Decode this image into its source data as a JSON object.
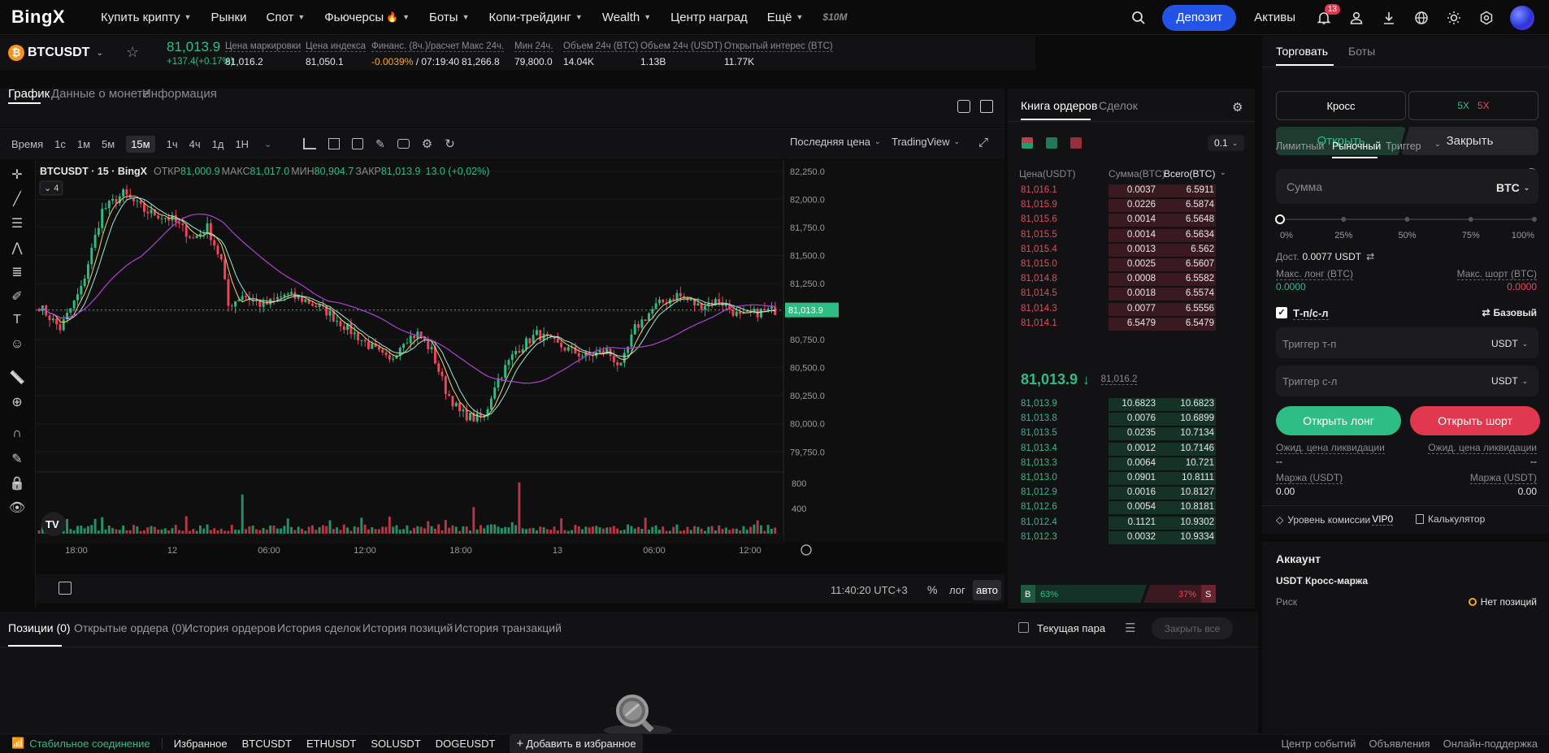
{
  "nav": {
    "logo": "BingX",
    "items": [
      {
        "label": "Купить крипту",
        "caret": true
      },
      {
        "label": "Рынки",
        "caret": false
      },
      {
        "label": "Спот",
        "caret": true
      },
      {
        "label": "Фьючерсы",
        "caret": true,
        "fire": true
      },
      {
        "label": "Боты",
        "caret": true
      },
      {
        "label": "Копи-трейдинг",
        "caret": true
      },
      {
        "label": "Wealth",
        "caret": true
      },
      {
        "label": "Центр наград",
        "caret": false
      },
      {
        "label": "Ещё",
        "caret": true
      }
    ],
    "promo": "$10M",
    "deposit": "Депозит",
    "assets": "Активы",
    "notif_count": "13"
  },
  "ticker": {
    "symbol": "BTCUSDT",
    "price": "81,013.9",
    "change": "+137.4(+0.17%)",
    "stats": [
      {
        "label": "Цена маркировки",
        "value": "81,016.2"
      },
      {
        "label": "Цена индекса",
        "value": "81,050.1"
      },
      {
        "label": "Финанс. (8ч.)/расчет",
        "value_red": "-0.0039%",
        "value": " / 07:19:40"
      },
      {
        "label": "Макс 24ч.",
        "value": "81,266.8"
      },
      {
        "label": "Мин 24ч.",
        "value": "79,800.0"
      },
      {
        "label": "Объем 24ч (BTC)",
        "value": "14.04K"
      },
      {
        "label": "Объем 24ч (USDT)",
        "value": "1.13B"
      },
      {
        "label": "Открытый интерес (BTC)",
        "value": "11.77K"
      }
    ]
  },
  "chart_tabs": [
    "График",
    "Данные о монете",
    "Информация"
  ],
  "toolbar": {
    "timeframes": [
      "Время",
      "1с",
      "1м",
      "5м",
      "15м",
      "1ч",
      "4ч",
      "1д",
      "1Н"
    ],
    "active": "15м",
    "price_type": "Последняя цена",
    "view": "TradingView"
  },
  "chart_data": {
    "type": "candlestick",
    "symbol_line": "BTCUSDT · 15 · BingX",
    "ohlc": {
      "o_label": "ОТКР",
      "o": "81,000.9",
      "h_label": "МАКС",
      "h": "81,017.0",
      "l_label": "МИН",
      "l": "80,904.7",
      "c_label": "ЗАКР",
      "c": "81,013.9",
      "chg": "13.0 (+0,02%)"
    },
    "indicator_count": "4",
    "y_ticks": [
      "82,250.0",
      "82,000.0",
      "81,750.0",
      "81,500.0",
      "81,250.0",
      "81,000.0",
      "80,750.0",
      "80,500.0",
      "80,250.0",
      "80,000.0",
      "79,750.0"
    ],
    "ylim": [
      79600,
      82350
    ],
    "last_price": "81,013.9",
    "last_price_value": 81013.9,
    "volume_ticks": [
      "800",
      "400"
    ],
    "x_ticks": [
      "18:00",
      "12",
      "06:00",
      "12:00",
      "18:00",
      "13",
      "06:00",
      "12:00"
    ],
    "waypoints": [
      [
        0,
        81050
      ],
      [
        6,
        80850
      ],
      [
        12,
        81200
      ],
      [
        18,
        81900
      ],
      [
        24,
        82050
      ],
      [
        30,
        81900
      ],
      [
        38,
        81820
      ],
      [
        44,
        81650
      ],
      [
        48,
        81750
      ],
      [
        52,
        81450
      ],
      [
        54,
        81050
      ],
      [
        58,
        81150
      ],
      [
        64,
        81050
      ],
      [
        70,
        81150
      ],
      [
        76,
        81100
      ],
      [
        82,
        81000
      ],
      [
        88,
        80850
      ],
      [
        96,
        80650
      ],
      [
        100,
        80550
      ],
      [
        104,
        80750
      ],
      [
        108,
        80800
      ],
      [
        112,
        80650
      ],
      [
        116,
        80300
      ],
      [
        120,
        80100
      ],
      [
        124,
        80050
      ],
      [
        127,
        80050
      ],
      [
        130,
        80350
      ],
      [
        136,
        80650
      ],
      [
        142,
        80800
      ],
      [
        148,
        80700
      ],
      [
        156,
        80600
      ],
      [
        162,
        80650
      ],
      [
        166,
        80500
      ],
      [
        170,
        80850
      ],
      [
        176,
        81050
      ],
      [
        182,
        81150
      ],
      [
        188,
        81050
      ],
      [
        194,
        81100
      ],
      [
        200,
        80950
      ],
      [
        206,
        81000
      ],
      [
        210,
        81010
      ]
    ],
    "volume_spikes": {
      "58": 620,
      "137": 810,
      "124": 420
    }
  },
  "chart_footer": {
    "time": "11:40:20 UTC+3",
    "pct": "%",
    "log": "лог",
    "auto": "авто"
  },
  "orderbook": {
    "tabs": [
      "Книга ордеров",
      "Сделок"
    ],
    "step": "0.1",
    "headers": [
      "Цена(USDT)",
      "Сумма(BTC)",
      "Всего(BTC)"
    ],
    "asks": [
      {
        "p": "81,016.1",
        "a": "0.0037",
        "t": "6.5911",
        "d": 1.0
      },
      {
        "p": "81,015.9",
        "a": "0.0226",
        "t": "6.5874",
        "d": 1.0
      },
      {
        "p": "81,015.6",
        "a": "0.0014",
        "t": "6.5648",
        "d": 1.0
      },
      {
        "p": "81,015.5",
        "a": "0.0014",
        "t": "6.5634",
        "d": 1.0
      },
      {
        "p": "81,015.4",
        "a": "0.0013",
        "t": "6.562",
        "d": 1.0
      },
      {
        "p": "81,015.0",
        "a": "0.0025",
        "t": "6.5607",
        "d": 1.0
      },
      {
        "p": "81,014.8",
        "a": "0.0008",
        "t": "6.5582",
        "d": 1.0
      },
      {
        "p": "81,014.5",
        "a": "0.0018",
        "t": "6.5574",
        "d": 1.0
      },
      {
        "p": "81,014.3",
        "a": "0.0077",
        "t": "6.5556",
        "d": 1.0
      },
      {
        "p": "81,014.1",
        "a": "6.5479",
        "t": "6.5479",
        "d": 1.0
      }
    ],
    "mid": "81,013.9",
    "mark": "81,016.2",
    "bids": [
      {
        "p": "81,013.9",
        "a": "10.6823",
        "t": "10.6823",
        "d": 1.0
      },
      {
        "p": "81,013.8",
        "a": "0.0076",
        "t": "10.6899",
        "d": 1.0
      },
      {
        "p": "81,013.5",
        "a": "0.0235",
        "t": "10.7134",
        "d": 1.0
      },
      {
        "p": "81,013.4",
        "a": "0.0012",
        "t": "10.7146",
        "d": 1.0
      },
      {
        "p": "81,013.3",
        "a": "0.0064",
        "t": "10.721",
        "d": 1.0
      },
      {
        "p": "81,013.0",
        "a": "0.0901",
        "t": "10.8111",
        "d": 1.0
      },
      {
        "p": "81,012.9",
        "a": "0.0016",
        "t": "10.8127",
        "d": 1.0
      },
      {
        "p": "81,012.6",
        "a": "0.0054",
        "t": "10.8181",
        "d": 1.0
      },
      {
        "p": "81,012.4",
        "a": "0.1121",
        "t": "10.9302",
        "d": 1.0
      },
      {
        "p": "81,012.3",
        "a": "0.0032",
        "t": "10.9334",
        "d": 1.0
      }
    ],
    "buy_label": "B",
    "buy_pct": "63%",
    "sell_pct": "37%",
    "sell_label": "S",
    "buy_ratio": 0.63
  },
  "trade": {
    "tabs": [
      "Торговать",
      "Боты"
    ],
    "margin_mode": "Кросс",
    "lev_long": "5X",
    "lev_short": "5X",
    "open": "Открыть",
    "close": "Закрыть",
    "order_types": [
      "Лимитный",
      "Рыночный",
      "Триггер"
    ],
    "amount_placeholder": "Сумма",
    "amount_unit": "BTC",
    "slider_marks": [
      "0%",
      "25%",
      "50%",
      "75%",
      "100%"
    ],
    "slider_value": 0,
    "avail_label": "Дост.",
    "avail_value": "0.0077 USDT",
    "max_long_label": "Макс. лонг (BTC)",
    "max_long": "0.0000",
    "max_short_label": "Макс. шорт (BTC)",
    "max_short": "0.0000",
    "tpsl": "Т-п/с-л",
    "basic": "Базовый",
    "tp_placeholder": "Триггер т-п",
    "sl_placeholder": "Триггер с-л",
    "unit": "USDT",
    "long_btn": "Открыть лонг",
    "short_btn": "Открыть шорт",
    "liq_label": "Ожид. цена ликвидации",
    "liq_long": "--",
    "liq_short": "--",
    "margin_label": "Маржа (USDT)",
    "margin_long": "0.00",
    "margin_short": "0.00",
    "fee_label": "Уровень комиссии",
    "fee_level": "VIP0",
    "calculator": "Калькулятор",
    "account": "Аккаунт",
    "account_mode": "USDT Кросс-маржа",
    "risk": "Риск",
    "no_positions": "Нет позиций"
  },
  "positions": {
    "tabs": [
      "Позиции (0)",
      "Открытые ордера (0)",
      "История ордеров",
      "История сделок",
      "История позиций",
      "История транзакций"
    ],
    "current_pair": "Текущая пара",
    "close_all": "Закрыть все"
  },
  "footer": {
    "connection": "Стабильное соединение",
    "favorites": "Избранное",
    "pairs": [
      "BTCUSDT",
      "ETHUSDT",
      "SOLUSDT",
      "DOGEUSDT"
    ],
    "add_fav": "Добавить в избранное",
    "right": [
      "Центр событий",
      "Объявления",
      "Онлайн-поддержка"
    ]
  },
  "colors": {
    "up": "#2ebd85",
    "down": "#f0455a",
    "accent": "#2354e6",
    "ma": "#b13fd6"
  }
}
